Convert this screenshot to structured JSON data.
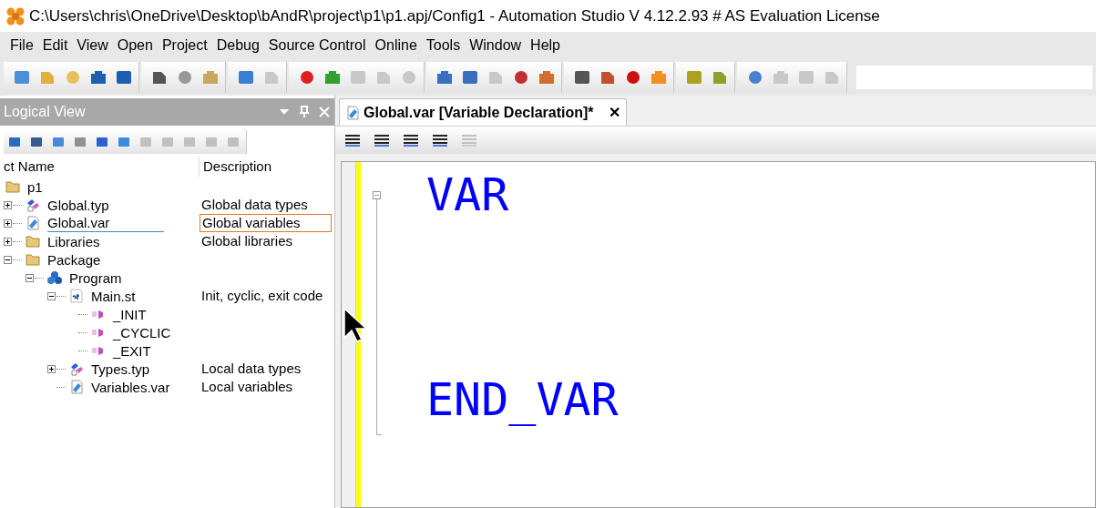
{
  "window": {
    "title": "C:\\Users\\chris\\OneDrive\\Desktop\\bAndR\\project\\p1\\p1.apj/Config1 - Automation Studio V 4.12.2.93 # AS Evaluation License"
  },
  "menu": [
    "File",
    "Edit",
    "View",
    "Open",
    "Project",
    "Debug",
    "Source Control",
    "Online",
    "Tools",
    "Window",
    "Help"
  ],
  "toolbar": {
    "groups": [
      [
        {
          "disabled": false
        },
        {
          "disabled": false
        },
        {
          "disabled": false
        },
        {
          "disabled": false
        },
        {
          "disabled": false
        }
      ],
      [
        {
          "disabled": false
        },
        {
          "disabled": false
        },
        {
          "disabled": false
        }
      ],
      [
        {
          "disabled": false
        },
        {
          "disabled": true
        }
      ],
      [
        {
          "disabled": false
        },
        {
          "disabled": false
        },
        {
          "disabled": true
        },
        {
          "disabled": true
        },
        {
          "disabled": true
        }
      ],
      [
        {
          "disabled": false
        },
        {
          "disabled": false
        },
        {
          "disabled": true
        },
        {
          "disabled": false
        },
        {
          "disabled": false
        }
      ],
      [
        {
          "disabled": false
        },
        {
          "disabled": false
        },
        {
          "disabled": false
        },
        {
          "disabled": false
        }
      ],
      [
        {
          "disabled": false
        },
        {
          "disabled": false
        }
      ],
      [
        {
          "disabled": false
        },
        {
          "disabled": true
        },
        {
          "disabled": true
        },
        {
          "disabled": true
        }
      ]
    ]
  },
  "logical_view": {
    "title": "Logical View",
    "toolbar": [
      {
        "disabled": false
      },
      {
        "disabled": false
      },
      {
        "disabled": false
      },
      {
        "disabled": false
      },
      {
        "disabled": false
      },
      {
        "disabled": false
      },
      {
        "disabled": true
      },
      {
        "disabled": true
      },
      {
        "disabled": true
      },
      {
        "disabled": true
      },
      {
        "disabled": true
      }
    ],
    "columns": [
      "ct Name",
      "Description"
    ],
    "tree": [
      {
        "name": "p1",
        "kind": "folder",
        "selected": false,
        "children": [
          {
            "name": "Global.typ",
            "description": "Global data types",
            "kind": "types",
            "expanded": false,
            "selected": false
          },
          {
            "name": "Global.var",
            "description": "Global variables",
            "kind": "var",
            "expanded": false,
            "selected": true
          },
          {
            "name": "Libraries",
            "description": "Global libraries",
            "kind": "folder",
            "expanded": false,
            "selected": false
          },
          {
            "name": "Package",
            "kind": "folder",
            "expanded": true,
            "selected": false,
            "children": [
              {
                "name": "Program",
                "kind": "program",
                "expanded": true,
                "selected": false,
                "children": [
                  {
                    "name": "Main.st",
                    "description": "Init, cyclic, exit code",
                    "kind": "st",
                    "expanded": true,
                    "selected": false,
                    "children": [
                      {
                        "name": "_INIT",
                        "kind": "action",
                        "selected": false
                      },
                      {
                        "name": "_CYCLIC",
                        "kind": "action",
                        "selected": false
                      },
                      {
                        "name": "_EXIT",
                        "kind": "action",
                        "selected": false
                      }
                    ]
                  },
                  {
                    "name": "Types.typ",
                    "description": "Local data types",
                    "kind": "types",
                    "expanded": false,
                    "selected": false
                  },
                  {
                    "name": "Variables.var",
                    "description": "Local variables",
                    "kind": "var",
                    "selected": false
                  }
                ]
              }
            ]
          }
        ]
      }
    ]
  },
  "editor": {
    "tabs": [
      {
        "label": "Global.var [Variable Declaration]*",
        "selected": true,
        "close": "✕"
      }
    ],
    "toolbar": [
      {
        "disabled": false
      },
      {
        "disabled": false
      },
      {
        "disabled": false
      },
      {
        "disabled": false
      },
      {
        "disabled": true
      }
    ],
    "lines": [
      "VAR",
      "END_VAR"
    ]
  }
}
